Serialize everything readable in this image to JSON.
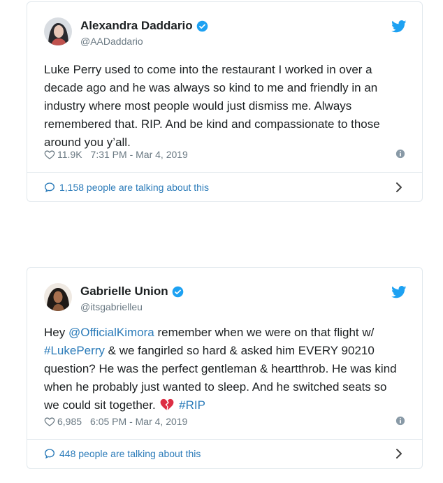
{
  "tweets": [
    {
      "name": "Alexandra Daddario",
      "handle": "@AADaddario",
      "text": "Luke Perry used to come into the restaurant I worked in over a decade ago and he was always so kind to me and friendly in an industry where most people would just dismiss me. Always remembered that. RIP. And be kind and compassionate to those around you y’all.",
      "likes": "11.9K",
      "timestamp": "7:31 PM - Mar 4, 2019",
      "talking": "1,158 people are talking about this"
    },
    {
      "name": "Gabrielle Union",
      "handle": "@itsgabrielleu",
      "text_parts": {
        "t1": "Hey ",
        "mention": "@OfficialKimora",
        "t2": " remember when we were on that flight w/ ",
        "hashtag1": "#LukePerry",
        "t3": " & we fangirled so hard & asked him EVERY 90210 question? He was the perfect gentleman & heartthrob. He was kind when he probably just wanted to sleep. And he switched seats so we could sit together. ",
        "hashtag2": "#RIP"
      },
      "likes": "6,985",
      "timestamp": "6:05 PM - Mar 4, 2019",
      "talking": "448 people are talking about this"
    }
  ],
  "colors": {
    "link": "#2b7bb9",
    "verified": "#1da1f2",
    "twitter_bird": "#1da1f2",
    "muted": "#697882",
    "broken_heart": "#dd2e44"
  },
  "icons": [
    "verified-icon",
    "twitter-bird-icon",
    "heart-icon",
    "info-icon",
    "speech-bubble-icon",
    "chevron-right-icon",
    "broken-heart-emoji"
  ]
}
